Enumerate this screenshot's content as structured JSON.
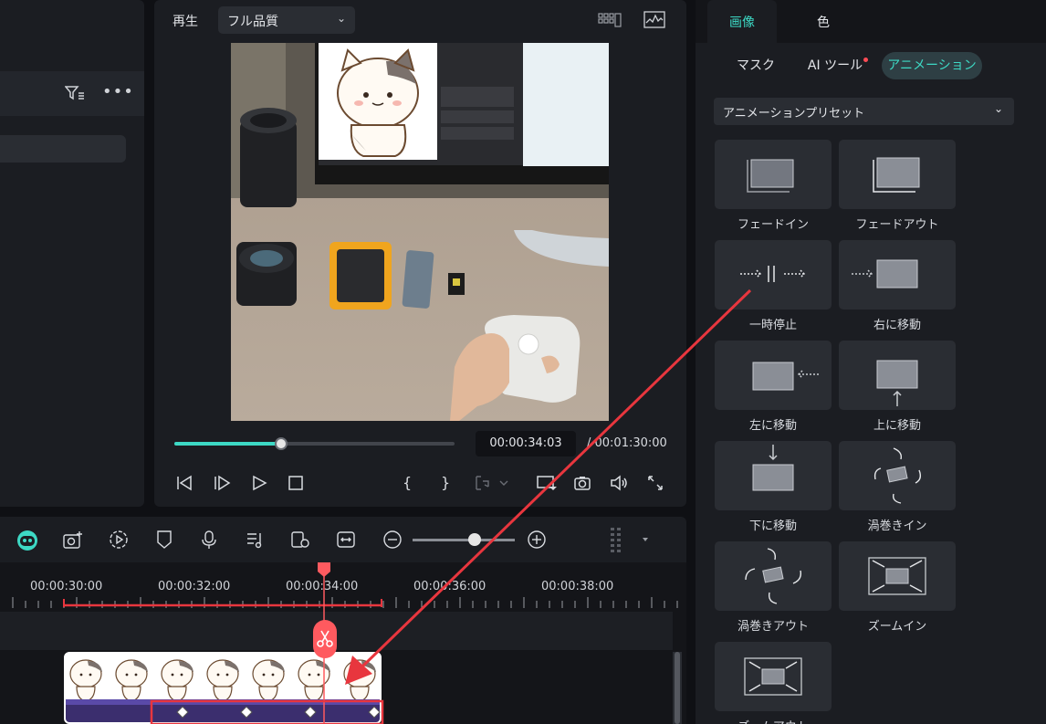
{
  "preview": {
    "play_label": "再生",
    "quality": "フル品質",
    "current_time": "00:00:34:03",
    "total_time": "/ 00:01:30:00",
    "progress_fraction": 0.38
  },
  "right_panel": {
    "tabs": [
      {
        "label": "画像",
        "active": true
      },
      {
        "label": "色",
        "active": false
      }
    ],
    "subtabs": [
      {
        "label": "マスク",
        "active": false
      },
      {
        "label": "AI ツール",
        "active": false,
        "dot": true
      },
      {
        "label": "アニメーション",
        "active": true
      }
    ],
    "preset_select": "アニメーションプリセット",
    "presets": [
      {
        "label": "フェードイン",
        "icon": "fade-in-icon"
      },
      {
        "label": "フェードアウト",
        "icon": "fade-out-icon"
      },
      {
        "label": "一時停止",
        "icon": "pause-icon"
      },
      {
        "label": "右に移動",
        "icon": "move-right-icon"
      },
      {
        "label": "左に移動",
        "icon": "move-left-icon"
      },
      {
        "label": "上に移動",
        "icon": "move-up-icon"
      },
      {
        "label": "下に移動",
        "icon": "move-down-icon"
      },
      {
        "label": "渦巻きイン",
        "icon": "swirl-in-icon"
      },
      {
        "label": "渦巻きアウト",
        "icon": "swirl-out-icon"
      },
      {
        "label": "ズームイン",
        "icon": "zoom-in-icon"
      },
      {
        "label": "ズームアウト",
        "icon": "zoom-out-icon"
      }
    ]
  },
  "timeline": {
    "ticks": [
      "00:00:30:00",
      "00:00:32:00",
      "00:00:34:00",
      "00:00:36:00",
      "00:00:38:00"
    ]
  },
  "colors": {
    "accent": "#3dd9c5",
    "annotation_red": "#e8363e",
    "clip_purple": "#3b2e6e"
  }
}
